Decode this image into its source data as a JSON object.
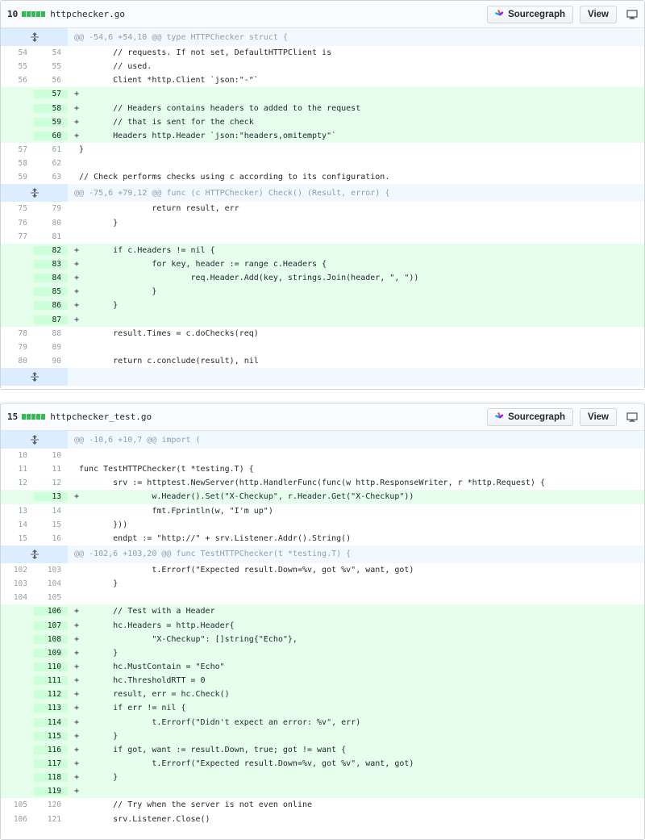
{
  "buttons": {
    "sourcegraph": "Sourcegraph",
    "view": "View"
  },
  "icons": {
    "sourcegraph": "sourcegraph-logo-icon",
    "unfold": "unfold-icon",
    "desktop": "desktop-icon"
  },
  "files": [
    {
      "additions": "10",
      "name": "httpchecker.go",
      "rows": [
        {
          "type": "hunk",
          "text": "@@ -54,6 +54,10 @@ type HTTPChecker struct {"
        },
        {
          "type": "ctx",
          "old": "54",
          "new": "54",
          "text": "        // requests. If not set, DefaultHTTPClient is"
        },
        {
          "type": "ctx",
          "old": "55",
          "new": "55",
          "text": "        // used."
        },
        {
          "type": "ctx",
          "old": "56",
          "new": "56",
          "text": "        Client *http.Client `json:\"-\"`"
        },
        {
          "type": "add",
          "old": "",
          "new": "57",
          "text": "+"
        },
        {
          "type": "add",
          "old": "",
          "new": "58",
          "text": "+       // Headers contains headers to added to the request"
        },
        {
          "type": "add",
          "old": "",
          "new": "59",
          "text": "+       // that is sent for the check"
        },
        {
          "type": "add",
          "old": "",
          "new": "60",
          "text": "+       Headers http.Header `json:\"headers,omitempty\"`"
        },
        {
          "type": "ctx",
          "old": "57",
          "new": "61",
          "text": " }"
        },
        {
          "type": "ctx",
          "old": "58",
          "new": "62",
          "text": ""
        },
        {
          "type": "ctx",
          "old": "59",
          "new": "63",
          "text": " // Check performs checks using c according to its configuration."
        },
        {
          "type": "hunk",
          "text": "@@ -75,6 +79,12 @@ func (c HTTPChecker) Check() (Result, error) {"
        },
        {
          "type": "ctx",
          "old": "75",
          "new": "79",
          "text": "                return result, err"
        },
        {
          "type": "ctx",
          "old": "76",
          "new": "80",
          "text": "        }"
        },
        {
          "type": "ctx",
          "old": "77",
          "new": "81",
          "text": ""
        },
        {
          "type": "add",
          "old": "",
          "new": "82",
          "text": "+       if c.Headers != nil {"
        },
        {
          "type": "add",
          "old": "",
          "new": "83",
          "text": "+               for key, header := range c.Headers {"
        },
        {
          "type": "add",
          "old": "",
          "new": "84",
          "text": "+                       req.Header.Add(key, strings.Join(header, \", \"))"
        },
        {
          "type": "add",
          "old": "",
          "new": "85",
          "text": "+               }"
        },
        {
          "type": "add",
          "old": "",
          "new": "86",
          "text": "+       }"
        },
        {
          "type": "add",
          "old": "",
          "new": "87",
          "text": "+"
        },
        {
          "type": "ctx",
          "old": "78",
          "new": "88",
          "text": "        result.Times = c.doChecks(req)"
        },
        {
          "type": "ctx",
          "old": "79",
          "new": "89",
          "text": ""
        },
        {
          "type": "ctx",
          "old": "80",
          "new": "90",
          "text": "        return c.conclude(result), nil"
        },
        {
          "type": "hunk",
          "text": ""
        }
      ]
    },
    {
      "additions": "15",
      "name": "httpchecker_test.go",
      "rows": [
        {
          "type": "hunk",
          "text": "@@ -10,6 +10,7 @@ import ("
        },
        {
          "type": "ctx",
          "old": "10",
          "new": "10",
          "text": ""
        },
        {
          "type": "ctx",
          "old": "11",
          "new": "11",
          "text": " func TestHTTPChecker(t *testing.T) {"
        },
        {
          "type": "ctx",
          "old": "12",
          "new": "12",
          "text": "        srv := httptest.NewServer(http.HandlerFunc(func(w http.ResponseWriter, r *http.Request) {"
        },
        {
          "type": "add",
          "old": "",
          "new": "13",
          "text": "+               w.Header().Set(\"X-Checkup\", r.Header.Get(\"X-Checkup\"))"
        },
        {
          "type": "ctx",
          "old": "13",
          "new": "14",
          "text": "                fmt.Fprintln(w, \"I'm up\")"
        },
        {
          "type": "ctx",
          "old": "14",
          "new": "15",
          "text": "        }))"
        },
        {
          "type": "ctx",
          "old": "15",
          "new": "16",
          "text": "        endpt := \"http://\" + srv.Listener.Addr().String()"
        },
        {
          "type": "hunk",
          "text": "@@ -102,6 +103,20 @@ func TestHTTPChecker(t *testing.T) {"
        },
        {
          "type": "ctx",
          "old": "102",
          "new": "103",
          "text": "                t.Errorf(\"Expected result.Down=%v, got %v\", want, got)"
        },
        {
          "type": "ctx",
          "old": "103",
          "new": "104",
          "text": "        }"
        },
        {
          "type": "ctx",
          "old": "104",
          "new": "105",
          "text": ""
        },
        {
          "type": "add",
          "old": "",
          "new": "106",
          "text": "+       // Test with a Header"
        },
        {
          "type": "add",
          "old": "",
          "new": "107",
          "text": "+       hc.Headers = http.Header{"
        },
        {
          "type": "add",
          "old": "",
          "new": "108",
          "text": "+               \"X-Checkup\": []string{\"Echo\"},"
        },
        {
          "type": "add",
          "old": "",
          "new": "109",
          "text": "+       }"
        },
        {
          "type": "add",
          "old": "",
          "new": "110",
          "text": "+       hc.MustContain = \"Echo\""
        },
        {
          "type": "add",
          "old": "",
          "new": "111",
          "text": "+       hc.ThresholdRTT = 0"
        },
        {
          "type": "add",
          "old": "",
          "new": "112",
          "text": "+       result, err = hc.Check()"
        },
        {
          "type": "add",
          "old": "",
          "new": "113",
          "text": "+       if err != nil {"
        },
        {
          "type": "add",
          "old": "",
          "new": "114",
          "text": "+               t.Errorf(\"Didn't expect an error: %v\", err)"
        },
        {
          "type": "add",
          "old": "",
          "new": "115",
          "text": "+       }"
        },
        {
          "type": "add",
          "old": "",
          "new": "116",
          "text": "+       if got, want := result.Down, true; got != want {"
        },
        {
          "type": "add",
          "old": "",
          "new": "117",
          "text": "+               t.Errorf(\"Expected result.Down=%v, got %v\", want, got)"
        },
        {
          "type": "add",
          "old": "",
          "new": "118",
          "text": "+       }"
        },
        {
          "type": "add",
          "old": "",
          "new": "119",
          "text": "+"
        },
        {
          "type": "ctx",
          "old": "105",
          "new": "120",
          "text": "        // Try when the server is not even online"
        },
        {
          "type": "ctx",
          "old": "106",
          "new": "121",
          "text": "        srv.Listener.Close()"
        }
      ]
    }
  ]
}
